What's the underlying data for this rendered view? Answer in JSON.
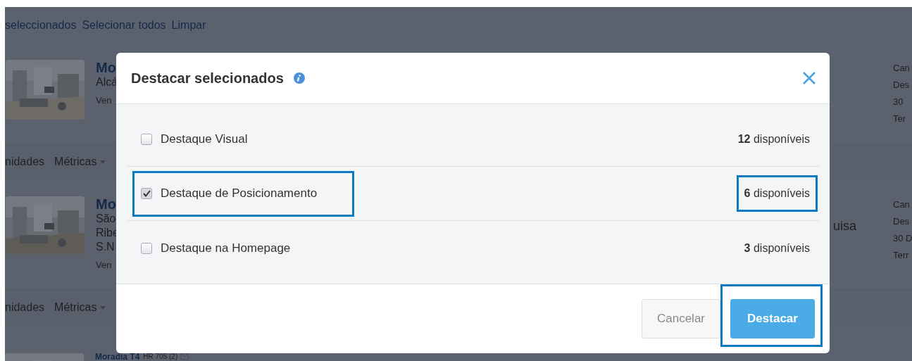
{
  "page": {
    "selection_bar": {
      "count_text": "seleccionados",
      "links": [
        "Selecionar todos",
        "Limpar"
      ]
    },
    "sections": [
      {
        "kind": "listing",
        "title": "Mo",
        "lines": [
          "Alcá"
        ],
        "footer": "Ven",
        "right_lines": [
          "Can",
          "Des",
          "30",
          "Ter"
        ]
      },
      {
        "kind": "metrics",
        "left": "nidades",
        "menu": "Métricas"
      },
      {
        "kind": "listing",
        "title": "Mo",
        "lines": [
          "São",
          "Ribe",
          "S.N"
        ],
        "footer": "Ven",
        "middle": "uisa",
        "right_lines": [
          "Can",
          "Des",
          "30 D",
          "Terr"
        ]
      },
      {
        "kind": "metrics",
        "left": "nidades",
        "menu": "Métricas"
      },
      {
        "kind": "listing_peek",
        "title": "Moradia T4",
        "reference": "HR 705 (2)"
      }
    ]
  },
  "modal": {
    "title": "Destacar selecionados",
    "options": [
      {
        "label": "Destaque Visual",
        "checked": false,
        "count": "**12** disponíveis",
        "highlighted": false
      },
      {
        "label": "Destaque de Posicionamento",
        "checked": true,
        "count": "**6** disponíveis",
        "highlighted": true
      },
      {
        "label": "Destaque na Homepage",
        "checked": false,
        "count": "**3** disponíveis",
        "highlighted": false
      }
    ],
    "buttons": [
      {
        "kind": "secondary",
        "label": "Cancelar",
        "highlighted": false
      },
      {
        "kind": "primary",
        "label": "Destacar",
        "highlighted": true
      }
    ]
  }
}
